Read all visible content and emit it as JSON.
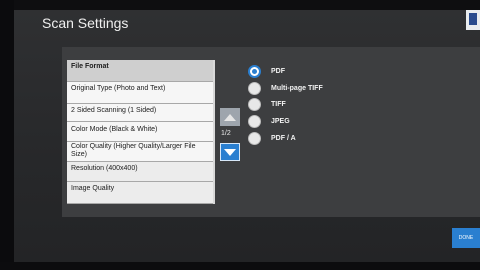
{
  "window": {
    "title": "Scan Settings"
  },
  "settings_list": [
    {
      "label": "File Format"
    },
    {
      "label": "Original Type (Photo and Text)"
    },
    {
      "label": "2 Sided Scanning (1 Sided)"
    },
    {
      "label": "Color Mode (Black & White)"
    },
    {
      "label": "Color Quality (Higher Quality/Larger File Size)"
    },
    {
      "label": "Resolution (400x400)"
    },
    {
      "label": "Image Quality"
    }
  ],
  "pager": {
    "text": "1/2"
  },
  "file_format_options": [
    {
      "label": "PDF",
      "selected": true
    },
    {
      "label": "Multi-page TIFF",
      "selected": false
    },
    {
      "label": "TIFF",
      "selected": false
    },
    {
      "label": "JPEG",
      "selected": false
    },
    {
      "label": "PDF / A",
      "selected": false
    }
  ],
  "buttons": {
    "done": "DONE"
  },
  "icons": {
    "up": "arrow-up-icon",
    "down": "arrow-down-icon"
  },
  "colors": {
    "accent": "#2a7fd0"
  }
}
